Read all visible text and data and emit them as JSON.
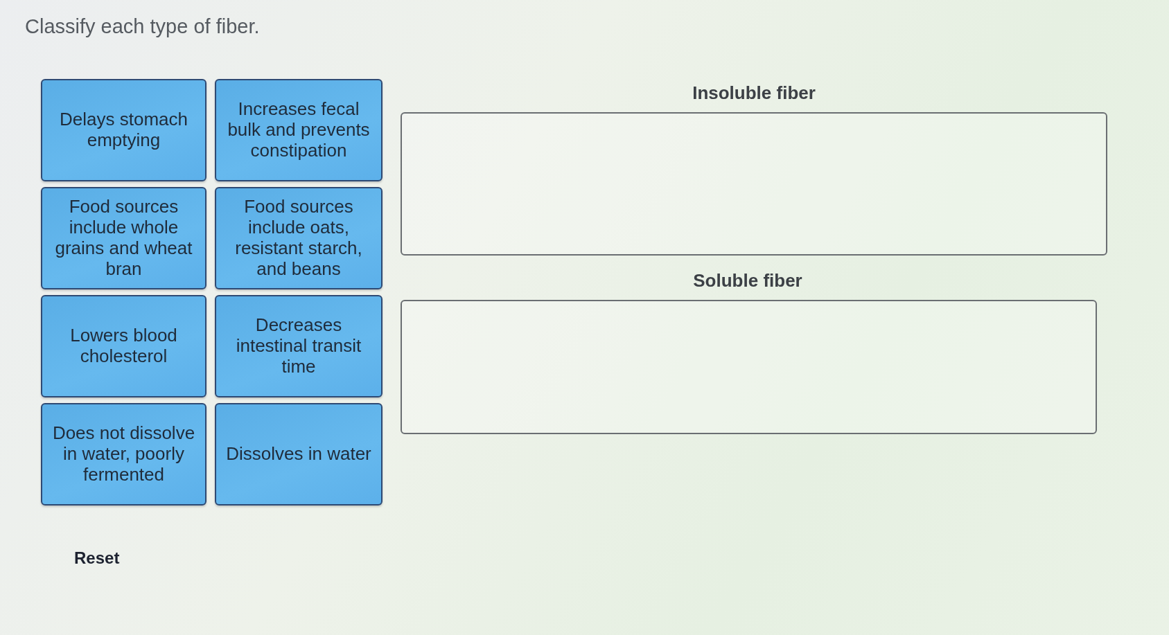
{
  "title": "Classify each type of fiber.",
  "cards": [
    "Delays stomach emptying",
    "Increases fecal bulk and prevents constipation",
    "Food sources include whole grains and wheat bran",
    "Food sources include oats, resistant starch, and beans",
    "Lowers blood cholesterol",
    "Decreases intestinal transit time",
    "Does not dissolve in water, poorly fermented",
    "Dissolves in water"
  ],
  "bins": [
    {
      "label": "Insoluble fiber"
    },
    {
      "label": "Soluble fiber"
    }
  ],
  "reset": "Reset"
}
